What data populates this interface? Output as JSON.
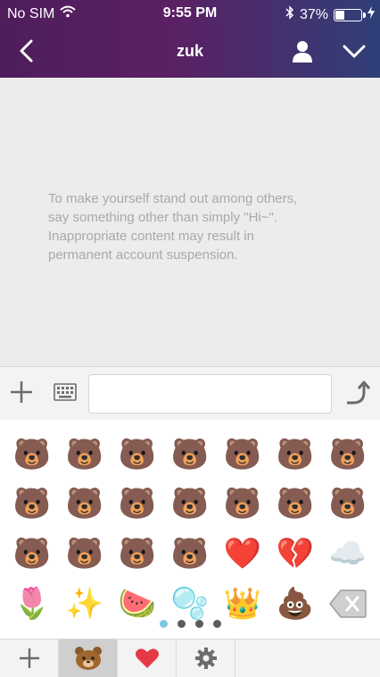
{
  "status_bar": {
    "carrier": "No SIM",
    "time": "9:55 PM",
    "battery": "37%",
    "battery_level": 0.37
  },
  "nav": {
    "title": "zuk"
  },
  "chat": {
    "notice_lines": [
      "To make yourself stand out among others,",
      "say something other than simply \"Hi~\".",
      "Inappropriate content may result in",
      "permanent account suspension."
    ]
  },
  "input": {
    "value": "",
    "placeholder": ""
  },
  "emoji_panel": {
    "pages": 4,
    "active_page": 1,
    "rows": [
      [
        "🐻",
        "🐻",
        "🐻",
        "🐻",
        "🐻",
        "🐻",
        "🐻"
      ],
      [
        "🐻",
        "🐻",
        "🐻",
        "🐻",
        "🐻",
        "🐻",
        "🐻"
      ],
      [
        "🐻",
        "🐻",
        "🐻",
        "🐻",
        "❤️",
        "💔",
        "☁️"
      ],
      [
        "🌷",
        "✨",
        "🍉",
        "🫧",
        "👑",
        "💩"
      ]
    ],
    "delete_icon": "backspace-icon"
  },
  "tabs": [
    {
      "icon": "plus-icon"
    },
    {
      "icon": "bear-icon",
      "active": true
    },
    {
      "icon": "heart-icon"
    },
    {
      "icon": "gear-icon"
    }
  ],
  "colors": {
    "header_start": "#4e1d5c",
    "header_end": "#2f3f78",
    "heart": "#e53946",
    "active_dot": "#7ec8e3"
  }
}
